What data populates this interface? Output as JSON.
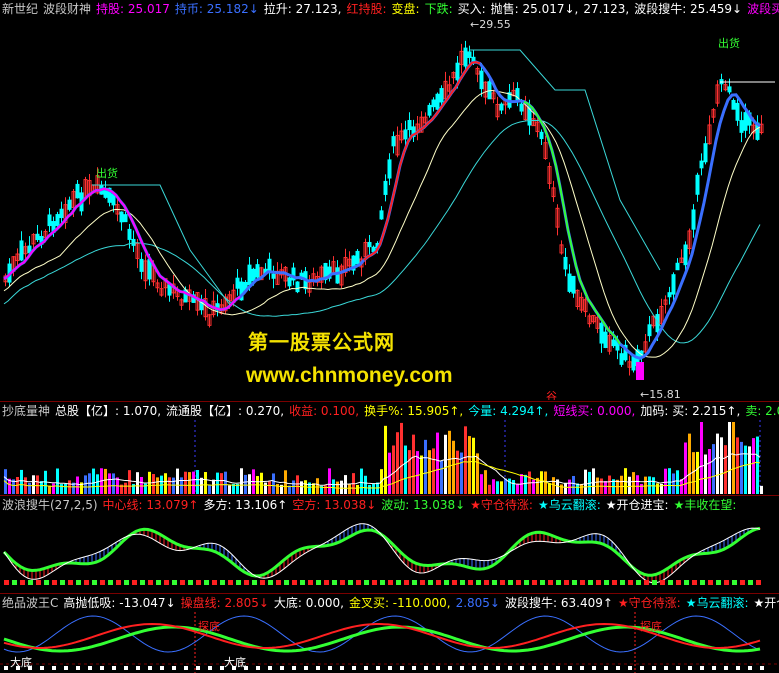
{
  "colors": {
    "up": "#ff3030",
    "down": "#00ffff",
    "bg": "#000000",
    "white": "#ffffff",
    "yellow": "#ffff00",
    "blue": "#3a6fff",
    "green": "#33ff33",
    "magenta": "#ff00ff",
    "label": "#c8c8c8",
    "sep": "#7a0000",
    "teal": "#3ad8d8",
    "red": "#ff2020",
    "cyan": "#00ffff"
  },
  "main": {
    "header": [
      {
        "text": "新世纪",
        "color": "#c8c8c8"
      },
      {
        "text": "波段财神",
        "color": "#c8c8c8"
      },
      {
        "text": "持股: 25.017",
        "color": "#ff00ff"
      },
      {
        "text": "持币: 25.182↓",
        "color": "#3a6fff"
      },
      {
        "text": "拉升: 27.123,",
        "color": "#ffffff"
      },
      {
        "text": "红持股:",
        "color": "#ff2020"
      },
      {
        "text": "变盘:",
        "color": "#ffff00"
      },
      {
        "text": "下跌:",
        "color": "#33ff33"
      },
      {
        "text": "买入:",
        "color": "#ffffff"
      },
      {
        "text": "抛售: 25.017↓,",
        "color": "#ffffff"
      },
      {
        "text": "27.123,",
        "color": "#ffffff"
      },
      {
        "text": "波段搜牛: 25.459↓",
        "color": "#ffffff"
      },
      {
        "text": "波段买:",
        "color": "#ff00ff"
      },
      {
        "text": "波段...",
        "color": "#33ff33"
      }
    ],
    "annotations": {
      "high": "←29.55",
      "low": "←15.81",
      "ship1": "出货",
      "ship2": "出货",
      "marker": "谷"
    },
    "watermark_cn": "第一股票公式网",
    "watermark_url": "www.chnmoney.com"
  },
  "vol": {
    "header": [
      {
        "text": "抄底量神",
        "color": "#c8c8c8"
      },
      {
        "text": "总股【亿】: 1.070,",
        "color": "#ffffff"
      },
      {
        "text": "流通股【亿】: 0.270,",
        "color": "#ffffff"
      },
      {
        "text": "收益: 0.100,",
        "color": "#ff2020"
      },
      {
        "text": "换手%: 15.905↑,",
        "color": "#ffff00"
      },
      {
        "text": "今量: 4.294↑,",
        "color": "#00ffff"
      },
      {
        "text": "短线买: 0.000,",
        "color": "#ff00ff"
      },
      {
        "text": "加码: 买: 2.215↑,",
        "color": "#ffffff"
      },
      {
        "text": "卖: 2.079↑",
        "color": "#33ff33"
      },
      {
        "text": "空头成",
        "color": "#00ffff"
      }
    ]
  },
  "osc1": {
    "header": [
      {
        "text": "波浪搜牛(27,2,5)",
        "color": "#c8c8c8"
      },
      {
        "text": "中心线: 13.079↑",
        "color": "#ff2020"
      },
      {
        "text": "多方: 13.106↑",
        "color": "#ffffff"
      },
      {
        "text": "空方: 13.038↓",
        "color": "#ff2020"
      },
      {
        "text": "波动: 13.038↓",
        "color": "#33ff33"
      },
      {
        "text": "★守仓待涨:",
        "color": "#ff2020"
      },
      {
        "text": "★乌云翻滚:",
        "color": "#00ffff"
      },
      {
        "text": "★开仓进宝:",
        "color": "#ffffff"
      },
      {
        "text": "★丰收在望:",
        "color": "#33ff33"
      }
    ]
  },
  "osc2": {
    "header": [
      {
        "text": "绝品波王C",
        "color": "#c8c8c8"
      },
      {
        "text": "高抛低吸: -13.047↓",
        "color": "#ffffff"
      },
      {
        "text": "操盘线: 2.805↓",
        "color": "#ff2020"
      },
      {
        "text": "大底: 0.000,",
        "color": "#ffffff"
      },
      {
        "text": "金叉买: -110.000,",
        "color": "#ffff00"
      },
      {
        "text": "2.805↓",
        "color": "#3a6fff"
      },
      {
        "text": "波段搜牛: 63.409↑",
        "color": "#ffffff"
      },
      {
        "text": "★守仓待涨:",
        "color": "#ff2020"
      },
      {
        "text": "★乌云翻滚:",
        "color": "#00ffff"
      },
      {
        "text": "★开仓进宝:",
        "color": "#ffffff"
      }
    ],
    "labels": {
      "bottom1": "大底",
      "bottom2": "大底",
      "scout1": "探底",
      "scout2": "探底"
    }
  }
}
